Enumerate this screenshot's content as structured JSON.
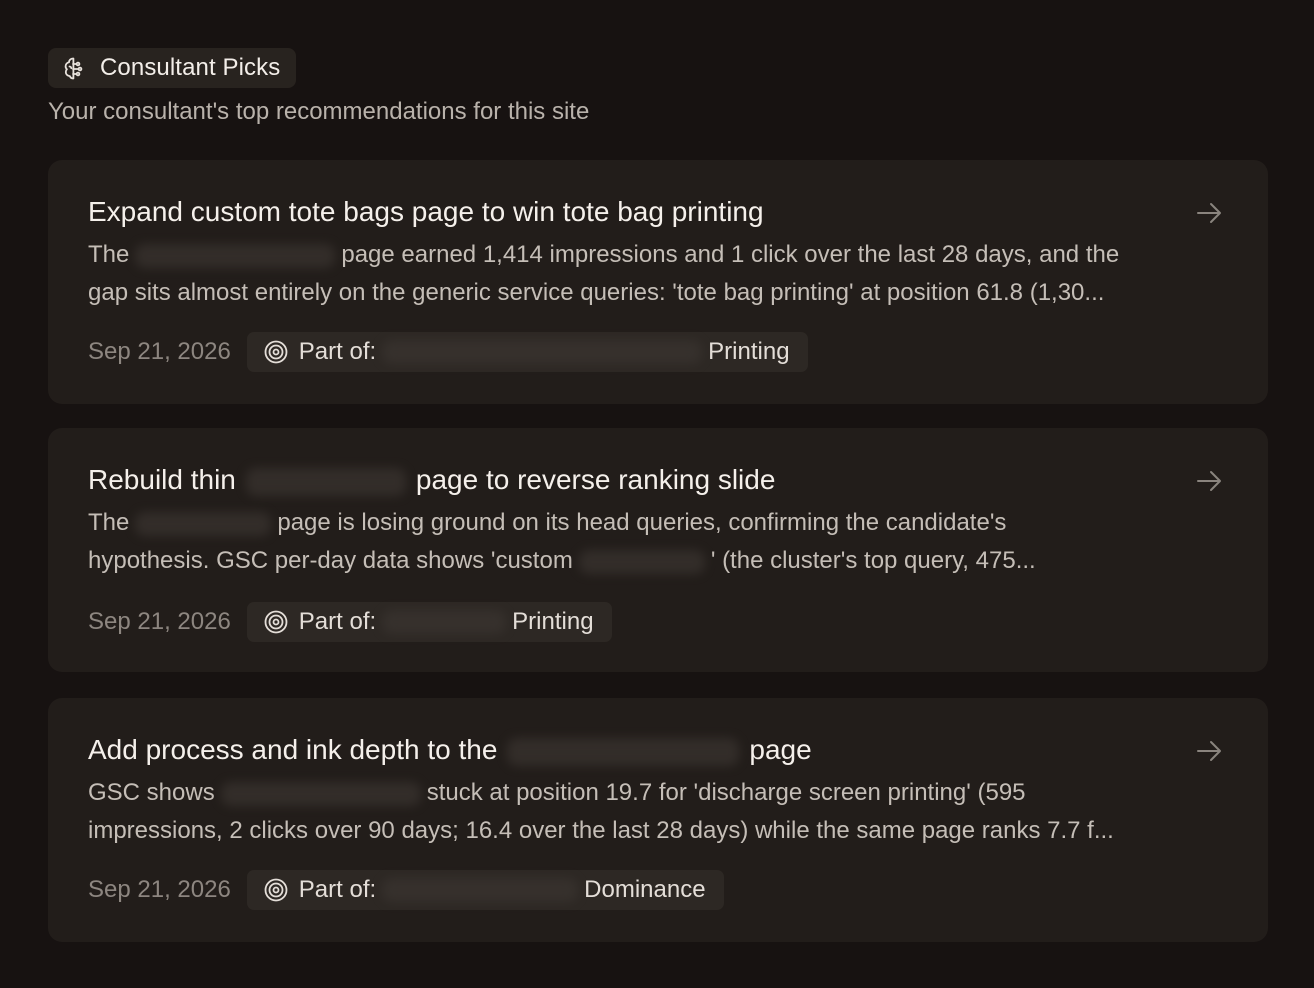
{
  "header": {
    "badge_icon": "brain-icon",
    "badge_label": "Consultant Picks",
    "subtitle": "Your consultant's top recommendations for this site"
  },
  "cards": [
    {
      "title_a": "Expand custom tote bags page to win tote bag printing",
      "body_l1_a": "The",
      "body_l1_b": "page earned 1,414 impressions and 1 click over the last 28 days, and the",
      "body_l2": "gap sits almost entirely on the generic service queries: 'tote bag printing' at position 61.8 (1,30...",
      "date": "Sep 21, 2026",
      "part_label": "Part of:",
      "part_suffix": "Printing"
    },
    {
      "title_a": "Rebuild thin",
      "title_b": "page to reverse ranking slide",
      "body_l1_a": "The",
      "body_l1_b": "page is losing ground on its head queries, confirming the candidate's",
      "body_l2_a": "hypothesis. GSC per-day data shows 'custom",
      "body_l2_b": "' (the cluster's top query, 475...",
      "date": "Sep 21, 2026",
      "part_label": "Part of:",
      "part_suffix": "Printing"
    },
    {
      "title_a": "Add process and ink depth to the",
      "title_b": "page",
      "body_l1_a": "GSC shows",
      "body_l1_b": "stuck at position 19.7 for 'discharge screen printing' (595",
      "body_l2": "impressions, 2 clicks over 90 days; 16.4 over the last 28 days) while the same page ranks 7.7 f...",
      "date": "Sep 21, 2026",
      "part_label": "Part of:",
      "part_suffix": "Dominance"
    }
  ],
  "icons": {
    "arrow": "arrow-right-icon",
    "target": "target-icon"
  },
  "colors": {
    "background": "#171211",
    "card": "#221d1a",
    "chip": "#2d2824"
  }
}
